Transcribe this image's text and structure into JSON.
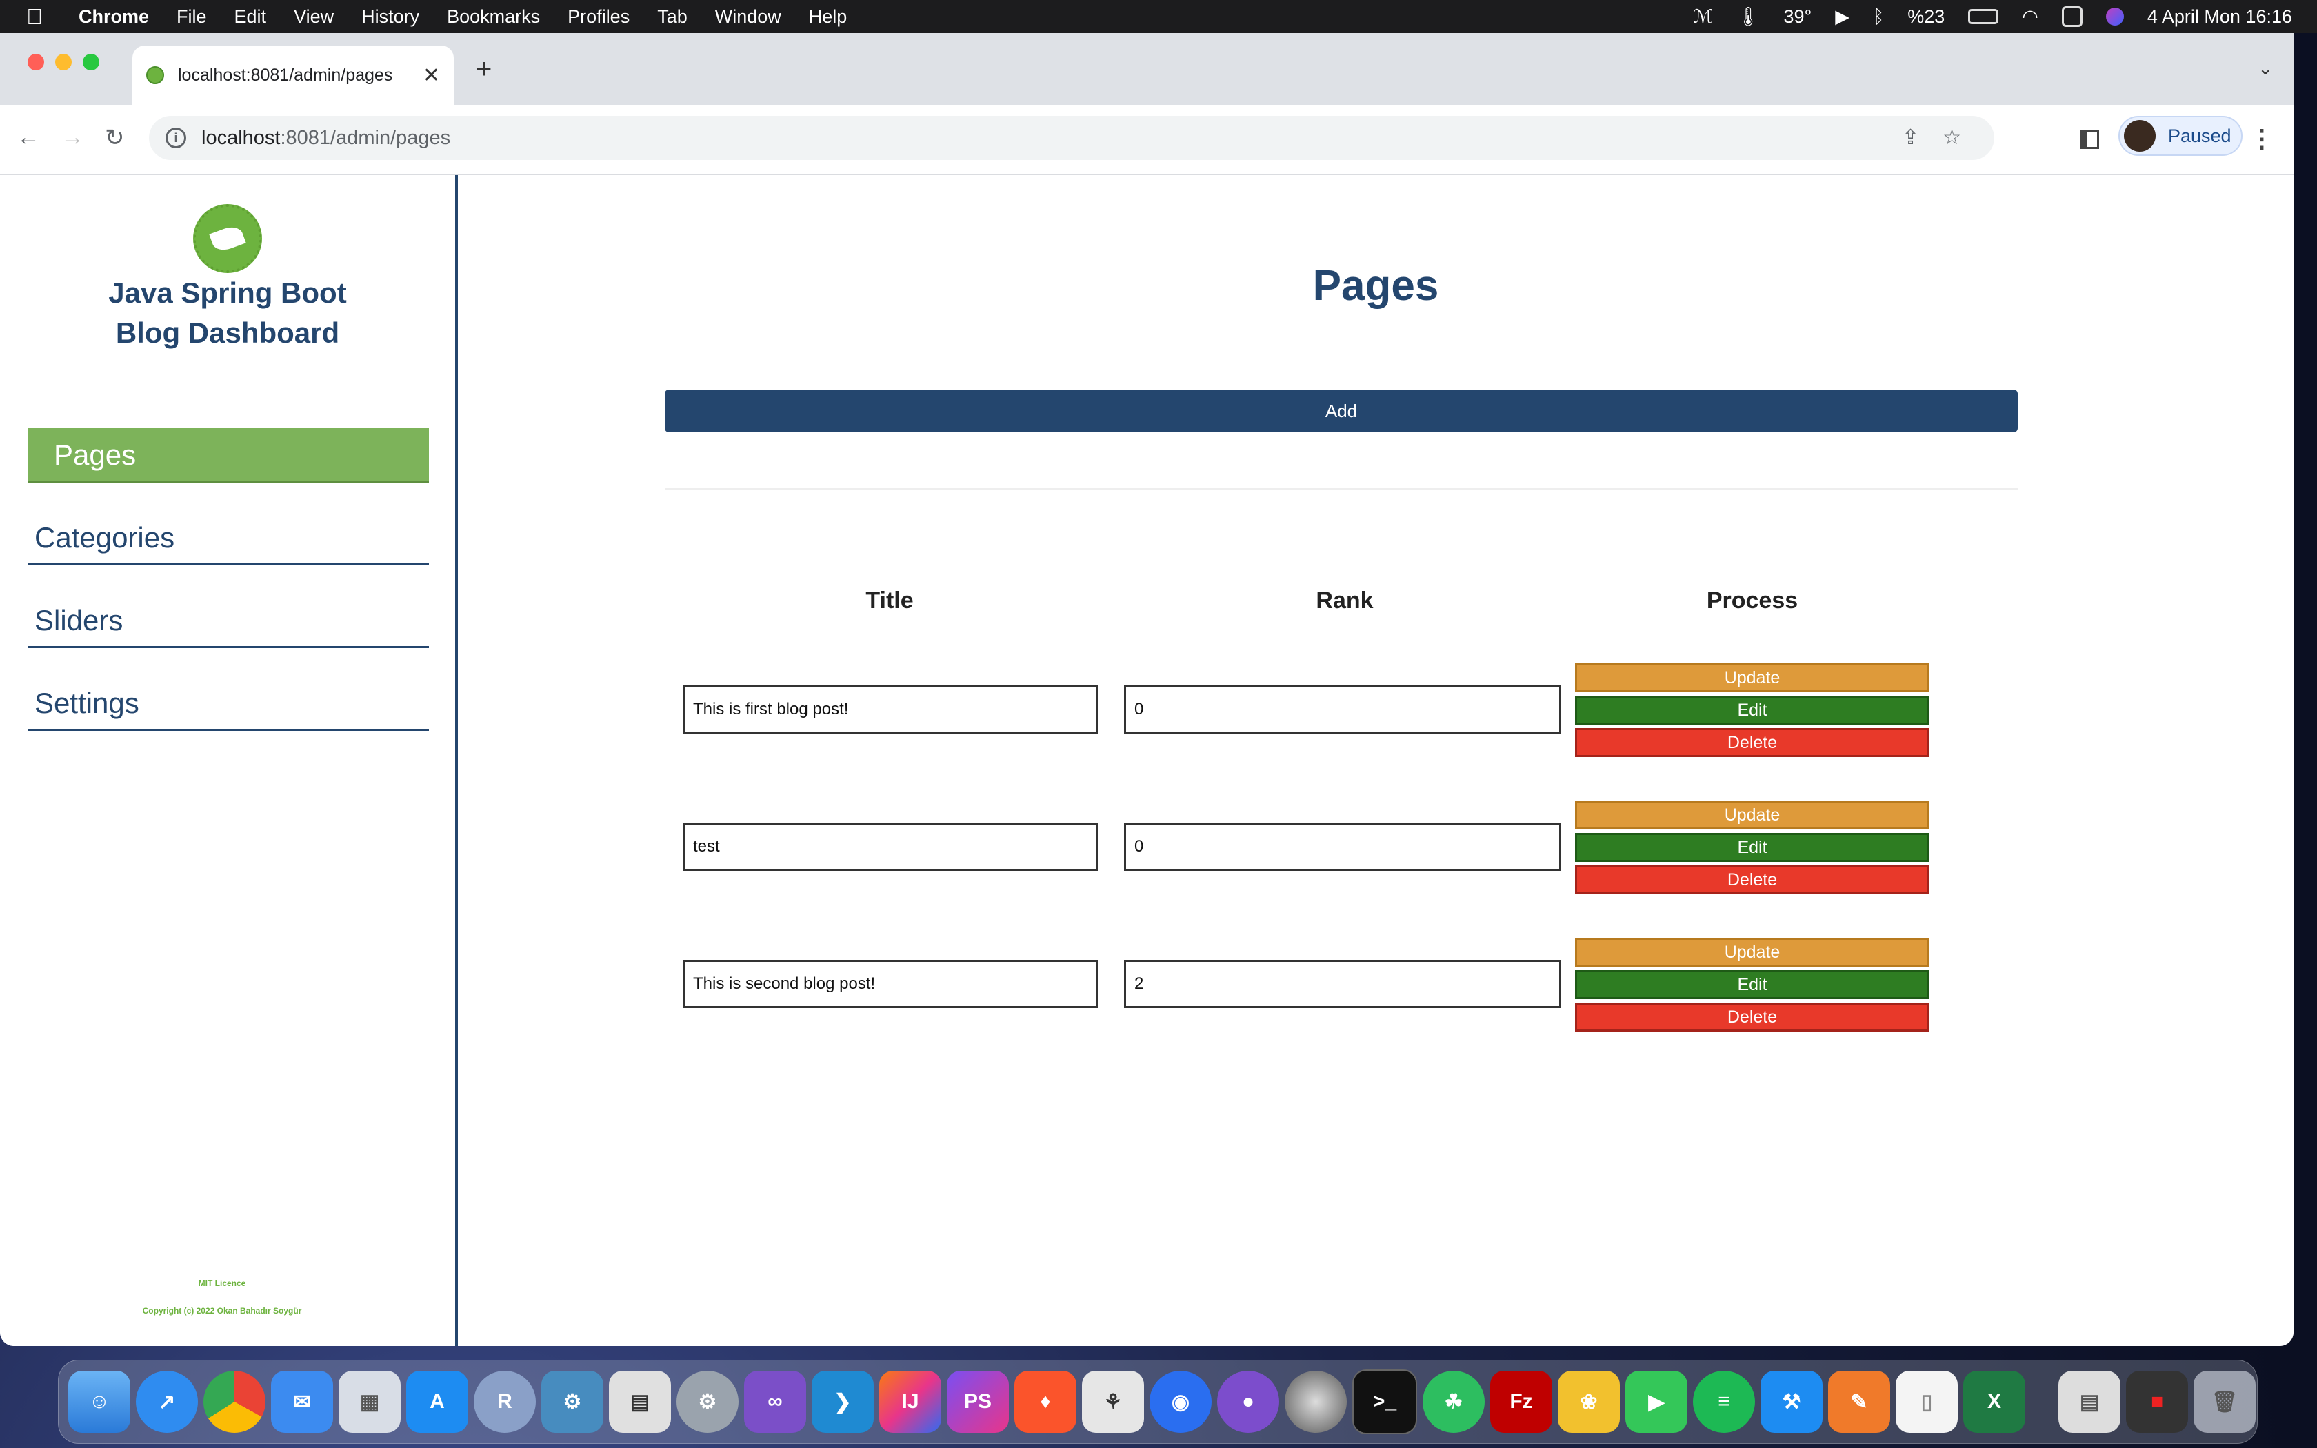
{
  "menubar": {
    "app_name": "Chrome",
    "menus": [
      "File",
      "Edit",
      "View",
      "History",
      "Bookmarks",
      "Profiles",
      "Tab",
      "Window",
      "Help"
    ],
    "temperature": "39°",
    "battery": "%23",
    "datetime": "4 April Mon  16:16"
  },
  "browser": {
    "tab_title": "localhost:8081/admin/pages",
    "url_host": "localhost",
    "url_path": ":8081/admin/pages",
    "profile_label": "Paused"
  },
  "sidebar": {
    "brand_line1": "Java Spring Boot",
    "brand_line2": "Blog Dashboard",
    "items": [
      {
        "label": "Pages",
        "active": true
      },
      {
        "label": "Categories",
        "active": false
      },
      {
        "label": "Sliders",
        "active": false
      },
      {
        "label": "Settings",
        "active": false
      }
    ],
    "footer_licence": "MIT Licence",
    "footer_copyright": "Copyright (c) 2022 Okan Bahadır Soygür"
  },
  "main": {
    "title": "Pages",
    "add_label": "Add",
    "columns": [
      "Title",
      "Rank",
      "Process"
    ],
    "rows": [
      {
        "title": "This is first blog post!",
        "rank": "0"
      },
      {
        "title": "test",
        "rank": "0"
      },
      {
        "title": "This is second blog post!",
        "rank": "2"
      }
    ],
    "actions": {
      "update": "Update",
      "edit": "Edit",
      "delete": "Delete"
    }
  },
  "dock": {
    "apps": [
      "Finder",
      "Safari",
      "Chrome",
      "Mail",
      "Launchpad",
      "App Store",
      "R",
      "Godot",
      "TablePlus",
      "System Preferences",
      "Visual Studio",
      "VS Code",
      "IntelliJ IDEA",
      "PhpStorm",
      "Brave",
      "Sequel Ace",
      "Proton VPN",
      "GitHub Desktop",
      "DVD Player",
      "Terminal",
      "Evernote",
      "FileZilla",
      "Cyberduck",
      "FaceTime",
      "Spotify",
      "Xcode",
      "Pages",
      "Preview",
      "Excel",
      "Trash"
    ]
  }
}
